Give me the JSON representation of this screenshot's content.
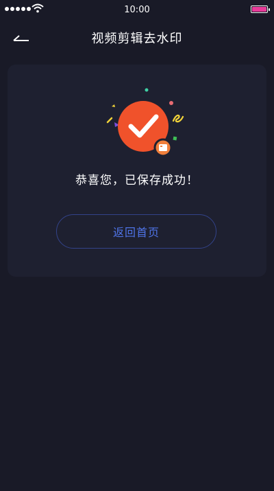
{
  "status_bar": {
    "time": "10:00",
    "signal_bars": 5,
    "battery_level": 1.0,
    "battery_color": "#e83b9a"
  },
  "nav": {
    "title": "视频剪辑去水印",
    "back_icon": "back-arrow-icon"
  },
  "result": {
    "message": "恭喜您，已保存成功！",
    "icon": "success-check-icon",
    "badge_icon": "save-badge-icon"
  },
  "actions": {
    "home_label": "返回首页"
  },
  "colors": {
    "background": "#191a27",
    "card": "#1e2030",
    "accent_orange": "#f0522b",
    "button_text": "#4f74e8",
    "button_border": "#33438a"
  }
}
